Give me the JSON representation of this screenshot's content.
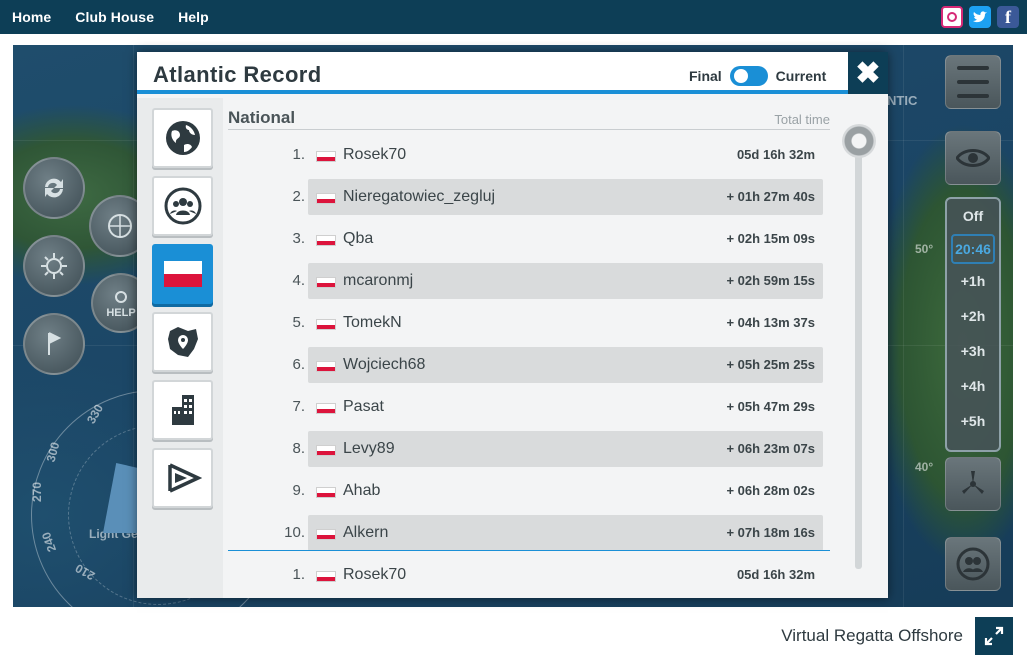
{
  "nav": {
    "home": "Home",
    "club_house": "Club House",
    "help": "Help"
  },
  "social": [
    "instagram-icon",
    "twitter-icon",
    "facebook-icon"
  ],
  "colors": {
    "brand_dark": "#0d3e56",
    "accent": "#1a8fd6",
    "poland_red": "#dc143c"
  },
  "game_hud": {
    "help_label": "HELP",
    "sail_label": "Light Ge",
    "compass_ticks": [
      "330",
      "300",
      "270",
      "240",
      "210"
    ],
    "lat_labels": [
      "50°",
      "40°"
    ],
    "map_text": "NTIC",
    "timeline": {
      "off": "Off",
      "now": "20:46",
      "steps": [
        "+1h",
        "+2h",
        "+3h",
        "+4h",
        "+5h"
      ]
    }
  },
  "modal": {
    "title": "Atlantic Record",
    "toggle_final": "Final",
    "toggle_current": "Current",
    "close_symbol": "✖",
    "categories": [
      {
        "name": "global",
        "icon": "globe-icon"
      },
      {
        "name": "friends",
        "icon": "group-icon"
      },
      {
        "name": "national",
        "icon": "flag-poland-icon",
        "active": true
      },
      {
        "name": "region",
        "icon": "map-pin-icon"
      },
      {
        "name": "city",
        "icon": "buildings-icon"
      },
      {
        "name": "team",
        "icon": "pennant-icon"
      }
    ],
    "list_title": "National",
    "list_sub": "Total time",
    "rows": [
      {
        "rank": "1.",
        "name": "Rosek70",
        "time": "05d 16h 32m"
      },
      {
        "rank": "2.",
        "name": "Nieregatowiec_zegluj",
        "time": "+ 01h 27m 40s"
      },
      {
        "rank": "3.",
        "name": "Qba",
        "time": "+ 02h 15m 09s"
      },
      {
        "rank": "4.",
        "name": "mcaronmj",
        "time": "+ 02h 59m 15s"
      },
      {
        "rank": "5.",
        "name": "TomekN",
        "time": "+ 04h 13m 37s"
      },
      {
        "rank": "6.",
        "name": "Wojciech68",
        "time": "+ 05h 25m 25s"
      },
      {
        "rank": "7.",
        "name": "Pasat",
        "time": "+ 05h 47m 29s"
      },
      {
        "rank": "8.",
        "name": "Levy89",
        "time": "+ 06h 23m 07s"
      },
      {
        "rank": "9.",
        "name": "Ahab",
        "time": "+ 06h 28m 02s"
      },
      {
        "rank": "10.",
        "name": "Alkern",
        "time": "+ 07h 18m 16s"
      }
    ],
    "self_row": {
      "rank": "1.",
      "name": "Rosek70",
      "time": "05d 16h 32m"
    }
  },
  "footer": {
    "title": "Virtual Regatta Offshore",
    "fullscreen_icon": "expand-icon"
  }
}
